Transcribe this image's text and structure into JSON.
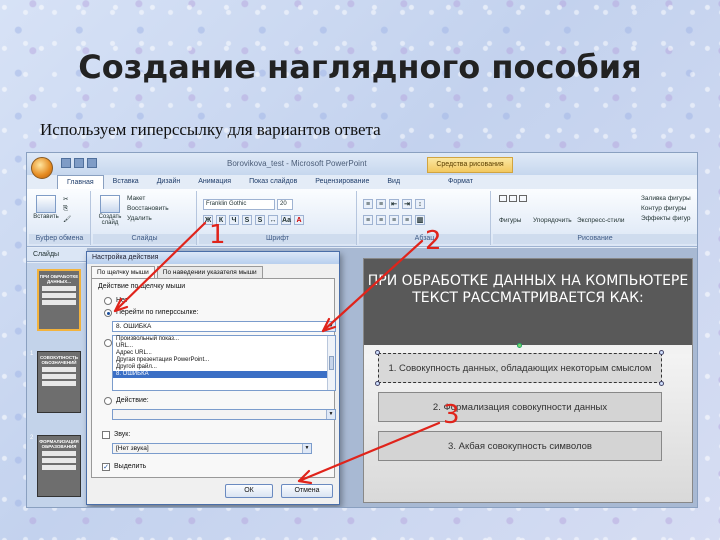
{
  "slide_title": "Создание наглядного пособия",
  "subtitle": "Используем  гиперссылку для вариантов ответа",
  "app": {
    "window_title": "Borovikova_test - Microsoft PowerPoint",
    "tools_tab": "Средства рисования",
    "tabs": [
      "Главная",
      "Вставка",
      "Дизайн",
      "Анимация",
      "Показ слайдов",
      "Рецензирование",
      "Вид",
      "Формат"
    ],
    "active_tab": "Главная"
  },
  "ribbon": {
    "clipboard": {
      "paste": "Вставить",
      "label": "Буфер обмена"
    },
    "slides": {
      "new_slide": "Создать слайд",
      "layout": "Макет",
      "reset": "Восстановить",
      "delete": "Удалить",
      "label": "Слайды"
    },
    "font": {
      "name": "Franklin Gothic",
      "size": "20",
      "label": "Шрифт"
    },
    "paragraph": {
      "label": "Абзац"
    },
    "drawing": {
      "shapes": "Фигуры",
      "arrange": "Упорядочить",
      "quick_styles": "Экспресс-стили",
      "fill": "Заливка фигуры",
      "outline": "Контур фигуры",
      "effects": "Эффекты фигур",
      "label": "Рисование"
    }
  },
  "pane": {
    "tab_label": "Слайды",
    "thumbs": [
      {
        "num": "",
        "title": "ПРИ ОБРАБОТКЕ ДАННЫХ..."
      },
      {
        "num": "1",
        "title": "СОВОКУПНОСТЬ ОБОЗНАЧЕНИЙ"
      },
      {
        "num": "2",
        "title": "ФОРМАЛИЗАЦИЯ ОБРАЗОВАНИЯ"
      }
    ]
  },
  "slide": {
    "question": "ПРИ ОБРАБОТКЕ ДАННЫХ НА КОМПЬЮТЕРЕ ТЕКСТ РАССМАТРИВАЕТСЯ КАК:",
    "answers": [
      "1. Совокупность данных, обладающих некоторым смыслом",
      "2. Формализация совокупности данных",
      "3. Акбая совокупность символов"
    ]
  },
  "dialog": {
    "title": "Настройка действия",
    "tabs": [
      "По щелчку мыши",
      "По наведении указателя мыши"
    ],
    "group_caption": "Действие по щелчку мыши",
    "option_none": "Нет",
    "option_hyperlink": "Перейти по гиперссылке:",
    "hyperlink_value": "8. ОШИБКА",
    "list_items": [
      "Произвольный показ...",
      "URL...",
      "Адрес URL...",
      "Другая презентация PowerPoint...",
      "Другой файл...",
      "8. ОШИБКА"
    ],
    "option_run": "Запуск программы:",
    "option_macro": "Действие:",
    "sound_label": "Звук:",
    "sound_value": "[Нет звука]",
    "highlight_label": "Выделить",
    "ok": "ОК",
    "cancel": "Отмена"
  },
  "annotations": [
    "1",
    "2",
    "3"
  ],
  "colors": {
    "annotation": "#e0241b",
    "slide_header": "#595959",
    "selection": "#3b6fc5"
  }
}
